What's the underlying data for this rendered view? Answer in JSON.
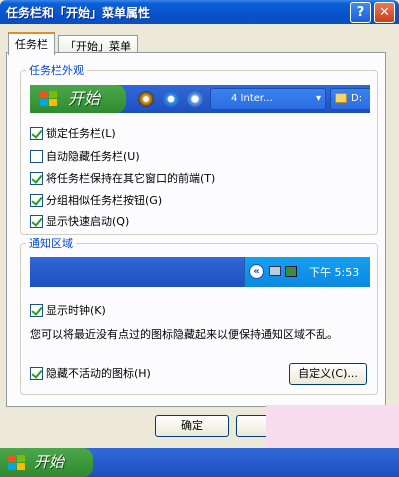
{
  "window": {
    "title": "任务栏和「开始」菜单属性",
    "help_label": "?",
    "close_label": "✕"
  },
  "tabs": [
    {
      "label": "任务栏",
      "active": true
    },
    {
      "label": "「开始」菜单",
      "active": false
    }
  ],
  "taskbar_group": {
    "label": "任务栏外观",
    "preview": {
      "start_label": "开始",
      "task_button_label": "4 Inter...",
      "folder_label": "D:"
    },
    "options": [
      {
        "label": "锁定任务栏(L)",
        "checked": true
      },
      {
        "label": "自动隐藏任务栏(U)",
        "checked": false
      },
      {
        "label": "将任务栏保持在其它窗口的前端(T)",
        "checked": true
      },
      {
        "label": "分组相似任务栏按钮(G)",
        "checked": true
      },
      {
        "label": "显示快速启动(Q)",
        "checked": true
      }
    ]
  },
  "notification_group": {
    "label": "通知区域",
    "preview": {
      "arrow": "«",
      "time": "下午 5:53"
    },
    "show_clock": {
      "label": "显示时钟(K)",
      "checked": true
    },
    "description": "您可以将最近没有点过的图标隐藏起来以便保持通知区域不乱。",
    "hide_inactive": {
      "label": "隐藏不活动的图标(H)",
      "checked": true
    },
    "customize_label": "自定义(C)..."
  },
  "buttons": {
    "ok": "确定"
  },
  "bottom_taskbar": {
    "start_label": "开始"
  },
  "colors": {
    "titlebar": "#0851c9",
    "group_label": "#0046d5",
    "checkmark": "#21a121",
    "start_green": "#3c9a3c"
  }
}
